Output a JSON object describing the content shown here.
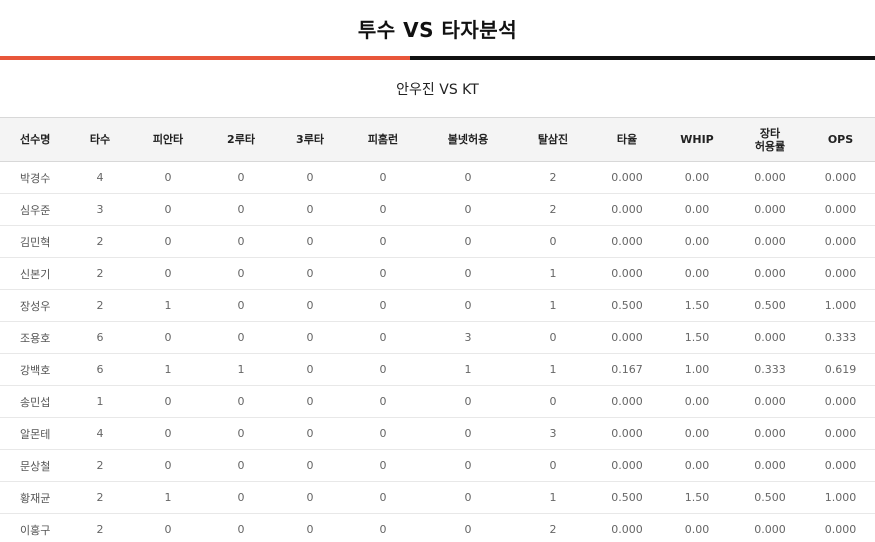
{
  "page": {
    "title": "투수 VS 타자분석",
    "matchup": "안우진 VS KT"
  },
  "colors": {
    "accent": "#e8563a",
    "dark": "#111111"
  },
  "table": {
    "headers": [
      "선수명",
      "타수",
      "피안타",
      "2루타",
      "3루타",
      "피홈런",
      "볼넷허용",
      "탈삼진",
      "타율",
      "WHIP",
      "장타\n허용률",
      "OPS"
    ],
    "rows": [
      [
        "박경수",
        "4",
        "0",
        "0",
        "0",
        "0",
        "0",
        "2",
        "0.000",
        "0.00",
        "0.000",
        "0.000"
      ],
      [
        "심우준",
        "3",
        "0",
        "0",
        "0",
        "0",
        "0",
        "2",
        "0.000",
        "0.00",
        "0.000",
        "0.000"
      ],
      [
        "김민혁",
        "2",
        "0",
        "0",
        "0",
        "0",
        "0",
        "0",
        "0.000",
        "0.00",
        "0.000",
        "0.000"
      ],
      [
        "신본기",
        "2",
        "0",
        "0",
        "0",
        "0",
        "0",
        "1",
        "0.000",
        "0.00",
        "0.000",
        "0.000"
      ],
      [
        "장성우",
        "2",
        "1",
        "0",
        "0",
        "0",
        "0",
        "1",
        "0.500",
        "1.50",
        "0.500",
        "1.000"
      ],
      [
        "조용호",
        "6",
        "0",
        "0",
        "0",
        "0",
        "3",
        "0",
        "0.000",
        "1.50",
        "0.000",
        "0.333"
      ],
      [
        "강백호",
        "6",
        "1",
        "1",
        "0",
        "0",
        "1",
        "1",
        "0.167",
        "1.00",
        "0.333",
        "0.619"
      ],
      [
        "송민섭",
        "1",
        "0",
        "0",
        "0",
        "0",
        "0",
        "0",
        "0.000",
        "0.00",
        "0.000",
        "0.000"
      ],
      [
        "알몬테",
        "4",
        "0",
        "0",
        "0",
        "0",
        "0",
        "3",
        "0.000",
        "0.00",
        "0.000",
        "0.000"
      ],
      [
        "문상철",
        "2",
        "0",
        "0",
        "0",
        "0",
        "0",
        "0",
        "0.000",
        "0.00",
        "0.000",
        "0.000"
      ],
      [
        "황재균",
        "2",
        "1",
        "0",
        "0",
        "0",
        "0",
        "1",
        "0.500",
        "1.50",
        "0.500",
        "1.000"
      ],
      [
        "이홍구",
        "2",
        "0",
        "0",
        "0",
        "0",
        "0",
        "2",
        "0.000",
        "0.00",
        "0.000",
        "0.000"
      ]
    ]
  }
}
